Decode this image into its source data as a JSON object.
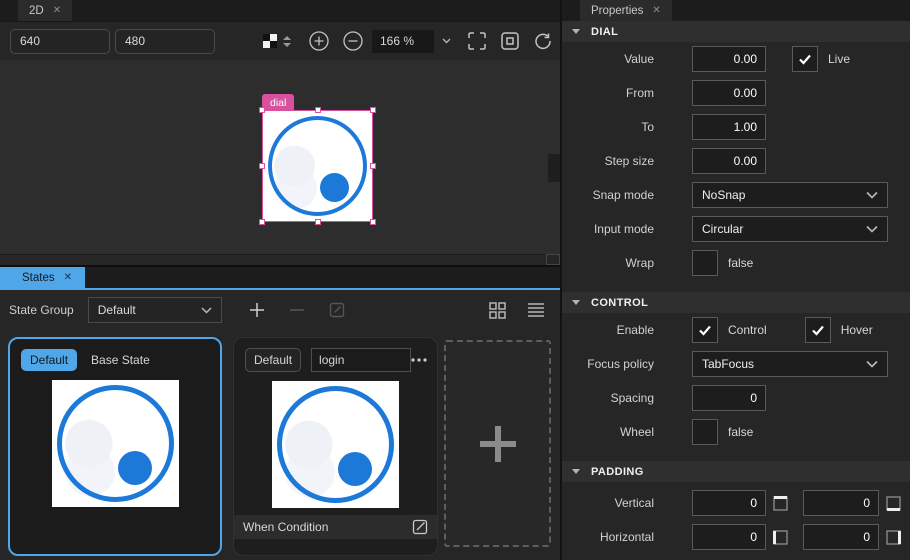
{
  "colors": {
    "accent": "#4fa6e8",
    "dial": "#1d79d8",
    "pink": "#d9509f"
  },
  "canvas_pane": {
    "tab_label": "2D",
    "close_icon": "✕",
    "width_field": "640",
    "height_field": "480",
    "zoom_level": "166 %",
    "selection_label": "dial"
  },
  "states_pane": {
    "tab_label": "States",
    "close_icon": "✕",
    "group_label": "State Group",
    "group_value": "Default",
    "cards": [
      {
        "badge": "Default",
        "name": "Base State",
        "selected": true
      },
      {
        "badge": "Default",
        "name": "login",
        "when_label": "When Condition",
        "more_icon": "···"
      }
    ]
  },
  "properties_pane": {
    "tab_label": "Properties",
    "close_icon": "✕",
    "dial": {
      "title": "DIAL",
      "value_label": "Value",
      "value": "0.00",
      "live_label": "Live",
      "live_checked": true,
      "from_label": "From",
      "from": "0.00",
      "to_label": "To",
      "to": "1.00",
      "step_label": "Step size",
      "step": "0.00",
      "snap_label": "Snap mode",
      "snap_value": "NoSnap",
      "input_label": "Input mode",
      "input_value": "Circular",
      "wrap_label": "Wrap",
      "wrap_value": "false",
      "wrap_checked": false
    },
    "control": {
      "title": "CONTROL",
      "enable_label": "Enable",
      "control_label": "Control",
      "control_checked": true,
      "hover_label": "Hover",
      "hover_checked": true,
      "focus_label": "Focus policy",
      "focus_value": "TabFocus",
      "spacing_label": "Spacing",
      "spacing_value": "0",
      "wheel_label": "Wheel",
      "wheel_value": "false",
      "wheel_checked": false
    },
    "padding": {
      "title": "PADDING",
      "vertical_label": "Vertical",
      "vertical_top": "0",
      "vertical_bottom": "0",
      "horizontal_label": "Horizontal",
      "horizontal_left": "0",
      "horizontal_right": "0"
    }
  }
}
